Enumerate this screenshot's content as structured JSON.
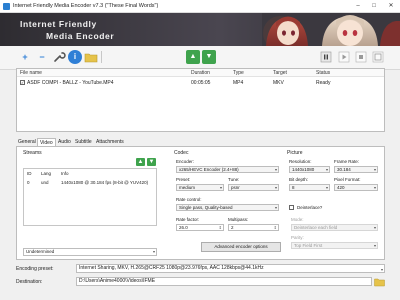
{
  "window": {
    "title": "Internet Friendly Media Encoder v7.3 (\"These Final Words\")",
    "minimize": "–",
    "maximize": "□",
    "close": "✕"
  },
  "banner": {
    "line1": "Internet Friendly",
    "line2": "Media Encoder"
  },
  "toolbar": {
    "add": "+",
    "remove": "−",
    "settings_icon": "wrench-icon",
    "info": "i",
    "open_icon": "folder-icon",
    "move_up": "▲",
    "move_down": "▼",
    "pause_icon": "pause-icon",
    "play_icon": "play-icon",
    "stop_icon": "stop-icon",
    "options_icon": "window-icon"
  },
  "filelist": {
    "columns": [
      "File name",
      "Duration",
      "Type",
      "Target",
      "Status"
    ],
    "rows": [
      {
        "checked": true,
        "name": "ASDF COMPI - BALLZ - YouTube.MP4",
        "duration": "00:05:05",
        "type": "MP4",
        "target": "MKV",
        "status": "Ready"
      }
    ]
  },
  "tabs": [
    "General",
    "Video",
    "Audio",
    "Subtitle",
    "Attachments"
  ],
  "streams": {
    "label": "Streams",
    "columns": [
      "ID",
      "Lang",
      "Info"
    ],
    "rows": [
      {
        "id": "0",
        "lang": "und",
        "info": "1440x1080 @ 30.184 fps (8-bit @ YUV420)"
      }
    ],
    "language_select": "Undetermined"
  },
  "codec": {
    "group_label": "Codec",
    "encoder_label": "Encoder:",
    "encoder_value": "x265/HEVC Encoder (2.4+88)",
    "preset_label": "Preset:",
    "preset_value": "medium",
    "tune_label": "Tune:",
    "tune_value": "psnr",
    "rate_control_label": "Rate control:",
    "rate_control_value": "Single pass, Quality-based",
    "rate_factor_label": "Rate factor:",
    "rate_factor_value": "26.0",
    "multipass_label": "Multipass:",
    "multipass_value": "2",
    "advanced_button": "Advanced encoder options"
  },
  "picture": {
    "group_label": "Picture",
    "resolution_label": "Resolution:",
    "resolution_value": "1440x1080",
    "frame_rate_label": "Frame Rate:",
    "frame_rate_value": "30.184",
    "bit_depth_label": "Bit depth:",
    "bit_depth_value": "8",
    "pixel_format_label": "Pixel Format:",
    "pixel_format_value": "420",
    "deinterlace_label": "Deinterlace?",
    "deinterlace_checked": false,
    "mode_label": "Mode:",
    "mode_value": "Deinterlace each field",
    "parity_label": "Parity:",
    "parity_value": "Top Field First"
  },
  "bottom": {
    "preset_label": "Encoding preset:",
    "preset_value": "Internet Sharing, MKV, H.265@CRF25 1080p@23.976fps, AAC 128kbps@44.1kHz",
    "destination_label": "Destination:",
    "destination_value": "D:\\Users\\Anime4000\\Videos\\IFME"
  },
  "colors": {
    "accent_green": "#3fa34d",
    "accent_blue": "#2f7fd6",
    "banner_bg": "#3a373d"
  }
}
